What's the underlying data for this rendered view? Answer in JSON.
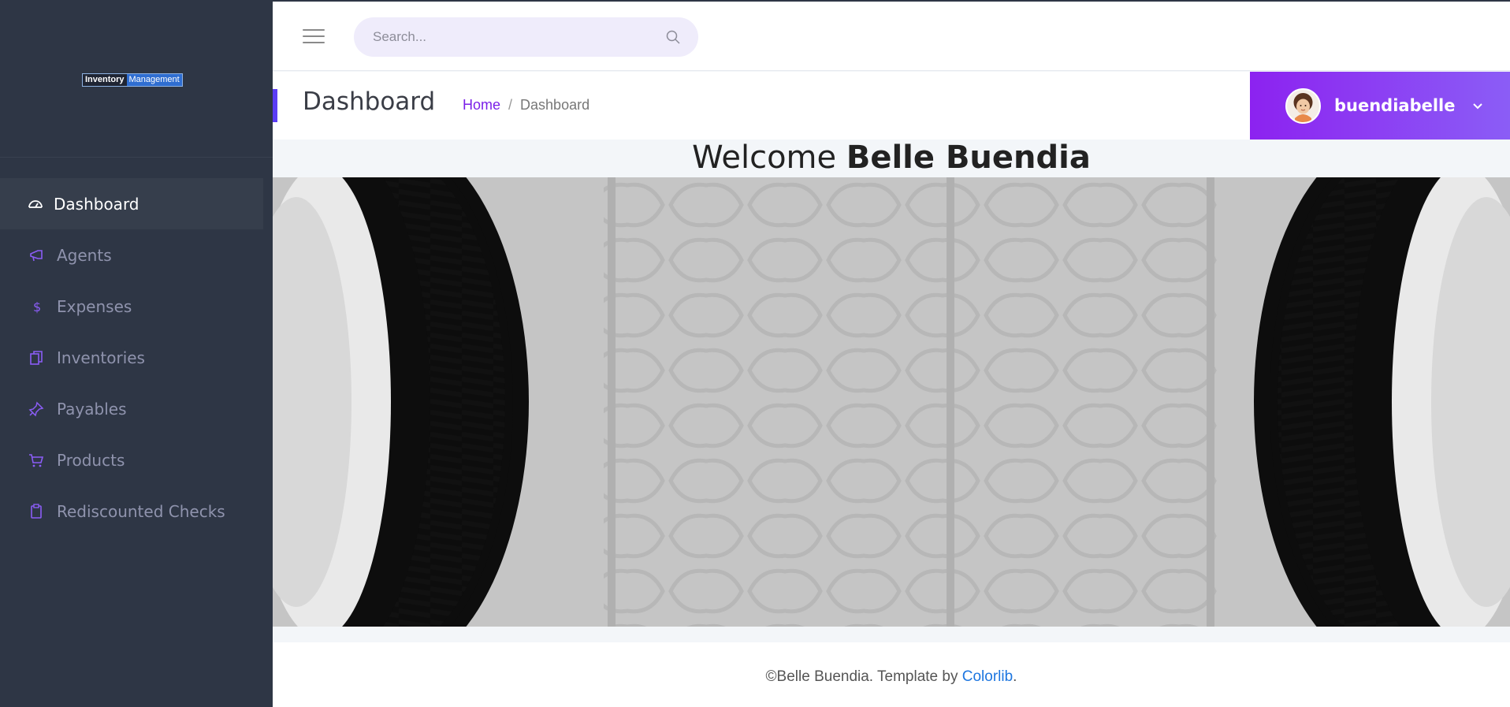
{
  "sidebar": {
    "logo": {
      "part1": "Inventory",
      "part2": "Management"
    },
    "items": [
      {
        "label": "Dashboard",
        "icon": "dashboard-icon",
        "active": true
      },
      {
        "label": "Agents",
        "icon": "megaphone-icon",
        "active": false
      },
      {
        "label": "Expenses",
        "icon": "dollar-icon",
        "active": false
      },
      {
        "label": "Inventories",
        "icon": "documents-icon",
        "active": false
      },
      {
        "label": "Payables",
        "icon": "pin-icon",
        "active": false
      },
      {
        "label": "Products",
        "icon": "cart-icon",
        "active": false
      },
      {
        "label": "Rediscounted Checks",
        "icon": "clipboard-icon",
        "active": false
      }
    ]
  },
  "topbar": {
    "search_placeholder": "Search..."
  },
  "header": {
    "title": "Dashboard",
    "breadcrumb": {
      "home": "Home",
      "separator": "/",
      "current": "Dashboard"
    },
    "user": {
      "username": "buendiabelle"
    }
  },
  "welcome": {
    "prefix": "Welcome",
    "name": "Belle Buendia"
  },
  "footer": {
    "text": "©Belle Buendia. Template by",
    "link": "Colorlib",
    "suffix": "."
  },
  "colors": {
    "sidebar": "#2e3645",
    "accent": "#8c22f0",
    "link": "#1d76e0"
  }
}
